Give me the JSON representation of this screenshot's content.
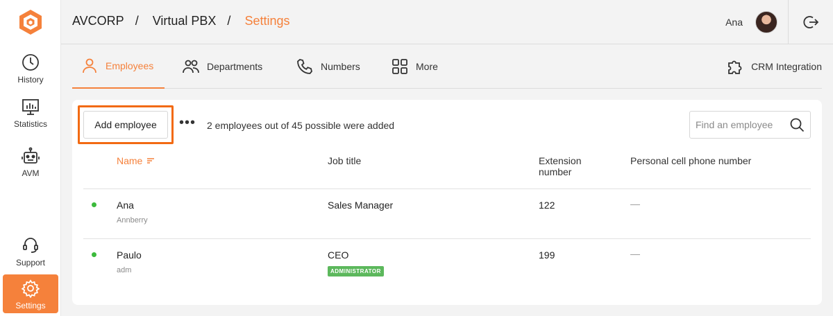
{
  "sidebar": {
    "items": [
      {
        "label": "History",
        "icon": "clock-icon"
      },
      {
        "label": "Statistics",
        "icon": "statistics-icon"
      },
      {
        "label": "AVM",
        "icon": "robot-icon"
      },
      {
        "label": "Support",
        "icon": "headset-icon"
      },
      {
        "label": "Settings",
        "icon": "gear-icon",
        "active": true
      }
    ]
  },
  "header": {
    "breadcrumb": [
      "AVCORP",
      "Virtual PBX",
      "Settings"
    ],
    "separator": "/",
    "user_name": "Ana"
  },
  "tabs": [
    {
      "label": "Employees",
      "icon": "user-icon",
      "active": true
    },
    {
      "label": "Departments",
      "icon": "group-icon"
    },
    {
      "label": "Numbers",
      "icon": "phone-icon"
    },
    {
      "label": "More",
      "icon": "grid-icon"
    },
    {
      "label": "CRM Integration",
      "icon": "puzzle-icon"
    }
  ],
  "toolbar": {
    "add_label": "Add employee",
    "more_label": "•••",
    "count_text": "2 employees out of 45 possible were added",
    "search_placeholder": "Find an employee"
  },
  "table": {
    "columns": [
      "Name",
      "Job title",
      "Extension number",
      "Personal cell phone number"
    ],
    "rows": [
      {
        "name": "Ana",
        "login": "Annberry",
        "job": "Sales Manager",
        "badge": "",
        "extension": "122",
        "phone": "—"
      },
      {
        "name": "Paulo",
        "login": "adm",
        "job": "CEO",
        "badge": "ADMINISTRATOR",
        "extension": "199",
        "phone": "—"
      }
    ]
  },
  "colors": {
    "accent": "#f5813b",
    "status_online": "#3cba3c",
    "badge_admin": "#5cb85c"
  }
}
